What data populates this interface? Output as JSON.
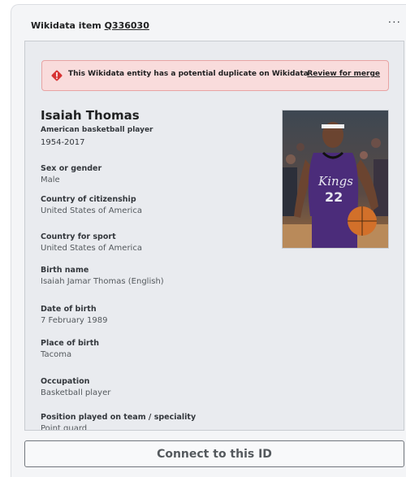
{
  "header": {
    "prefix": "Wikidata item ",
    "item_id": "Q336030",
    "more_icon": "ellipsis-icon"
  },
  "warning": {
    "icon": "warning-diamond-icon",
    "text": "This Wikidata entity has a potential duplicate on Wikidata",
    "link": "Review for merge",
    "color": "#d73333"
  },
  "entity": {
    "name": "Isaiah Thomas",
    "description": "American basketball player",
    "years": "1954-2017"
  },
  "properties": [
    {
      "key": "Sex or gender",
      "value": "Male"
    },
    {
      "key": "Country of citizenship",
      "value": "United States of America"
    },
    {
      "key": "Country for sport",
      "value": "United States of America"
    },
    {
      "key": "Birth name",
      "value": "Isaiah Jamar Thomas (English)"
    },
    {
      "key": "Date of birth",
      "value": "7 February 1989"
    },
    {
      "key": "Place of birth",
      "value": "Tacoma"
    },
    {
      "key": "Occupation",
      "value": "Basketball player"
    },
    {
      "key": "Position played on team / speciality",
      "value": "Point guard"
    }
  ],
  "photo": {
    "jersey_text": "Kings",
    "jersey_number": "22"
  },
  "connect_label": "Connect to this ID"
}
